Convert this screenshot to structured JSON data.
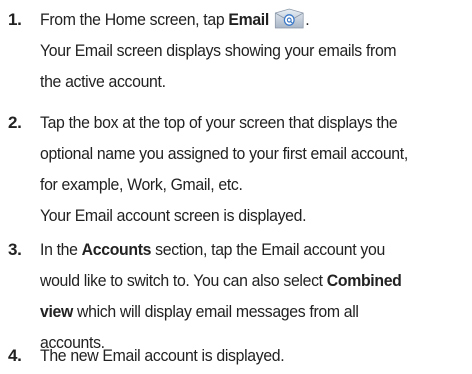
{
  "steps": [
    {
      "number": "1.",
      "line1_pre": "From the Home screen, tap ",
      "line1_bold": "Email",
      "line1_post": ".",
      "icon": "email-icon",
      "result_lines": [
        "Your Email screen displays showing your emails from",
        "the active account."
      ]
    },
    {
      "number": "2.",
      "lines": [
        "Tap the box at the top of your screen that displays the",
        "optional name you assigned to your first email account,",
        "for example, Work, Gmail, etc."
      ],
      "result_line": "Your Email account screen is displayed."
    },
    {
      "number": "3.",
      "line1_pre": "In the ",
      "line1_bold": "Accounts",
      "line1_post": " section, tap the Email account you",
      "line2_pre": "would like to switch to. You can also select ",
      "line2_bold": "Combined",
      "line3_bold": "view",
      "line3_post": " which will display email messages from all",
      "line4": "accounts."
    },
    {
      "number": "4.",
      "line1": "The new Email account is displayed."
    }
  ],
  "colors": {
    "text": "#222222",
    "icon_gradient_top": "#e8eef5",
    "icon_gradient_bottom": "#a9b6c6",
    "icon_accent": "#3a78c8"
  }
}
